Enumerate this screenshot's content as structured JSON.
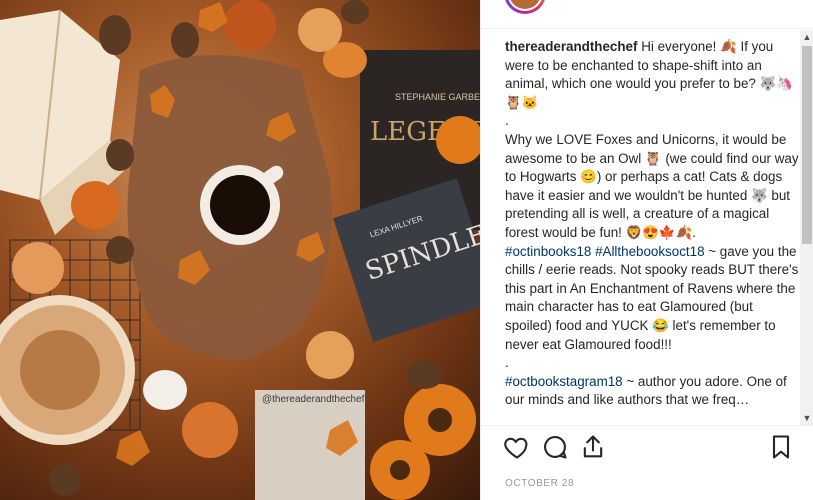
{
  "post": {
    "username": "thereaderandthechef",
    "caption_lines": [
      "Hi everyone! 🍂 If you were to be enchanted to shape-shift into an animal, which one would you prefer to be? 🐺🦄🦉🐱",
      ".",
      "Why we LOVE Foxes and Unicorns, it would be awesome to be an Owl 🦉 (we could find our way to Hogwarts 😊) or perhaps a cat! Cats & dogs have it easier and we wouldn't be hunted 🐺 but pretending all is well, a creature of a magical forest would be fun! 🦁😍🍁🍂."
    ],
    "hashtags_1": "#octinbooks18 #Allthebooksoct18",
    "text_after_hashtags_1": " ~ gave you the chills / eerie reads. Not spooky reads BUT there's this part in An Enchantment of Ravens where the main character has to eat Glamoured (but spoiled) food and YUCK 😂 let's remember to never eat Glamoured food!!!",
    "dot_2": ".",
    "hashtags_2": "#octbookstagram18",
    "text_after_hashtags_2": " ~ author you adore. One of our minds and like authors that we freq…",
    "date": "OCTOBER 28"
  },
  "photo": {
    "book_1_title": "LEGENDARY",
    "book_1_author": "STEPHANIE GARBER",
    "book_2_title": "SPINDLE FIRE",
    "book_2_author": "LEXA HILLYER",
    "watermark": "@thereaderandthechef"
  },
  "icons": {
    "like": "heart-icon",
    "comment": "comment-icon",
    "share": "share-icon",
    "save": "bookmark-icon"
  },
  "colors": {
    "username": "#262626",
    "hashtag": "#003569",
    "date": "#999999"
  }
}
